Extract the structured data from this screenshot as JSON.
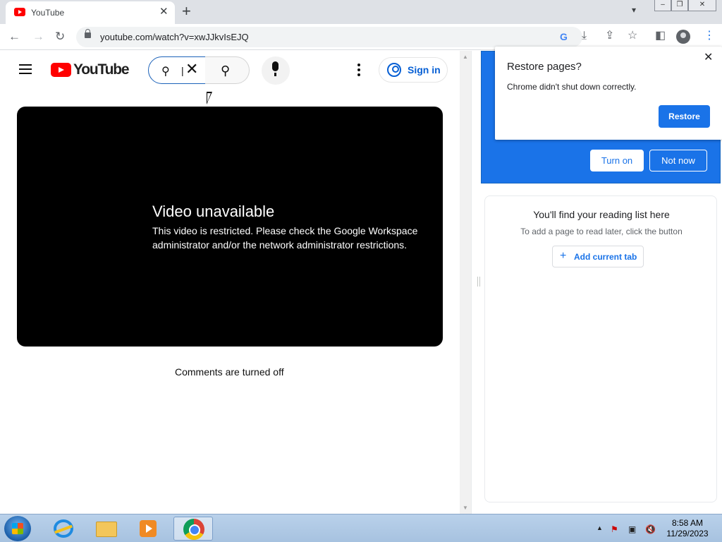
{
  "browser": {
    "tab": {
      "title": "YouTube",
      "close_glyph": "✕"
    },
    "new_tab_glyph": "+",
    "url": "youtube.com/watch?v=xwJJkvIsEJQ",
    "icons": [
      "back-icon",
      "forward-icon",
      "reload-icon",
      "lock-icon",
      "google-icon",
      "install-icon",
      "share-icon",
      "bookmark-star-icon",
      "side-panel-icon",
      "profile-icon",
      "menu-icon"
    ]
  },
  "youtube": {
    "logo_text": "YouTube",
    "search": {
      "value": "|",
      "clear_glyph": "✕"
    },
    "signin_label": "Sign in",
    "video": {
      "title": "Video unavailable",
      "message": "This video is restricted. Please check the Google Workspace administrator and/or the network administrator restrictions."
    },
    "comments_text": "Comments are turned off",
    "accent": "#ff0000",
    "link_color": "#065fd4"
  },
  "restore_dialog": {
    "title": "Restore pages?",
    "message": "Chrome didn't shut down correctly.",
    "button": "Restore",
    "close_glyph": "✕"
  },
  "promo": {
    "turn_on": "Turn on",
    "not_now": "Not now",
    "color": "#1a73e8"
  },
  "reading_list": {
    "title": "You'll find your reading list here",
    "subtitle": "To add a page to read later, click the button",
    "add_button": "Add current tab"
  },
  "taskbar": {
    "time": "8:58 AM",
    "date": "11/29/2023",
    "apps": [
      "internet-explorer-icon",
      "file-explorer-icon",
      "media-player-icon",
      "chrome-icon"
    ]
  }
}
